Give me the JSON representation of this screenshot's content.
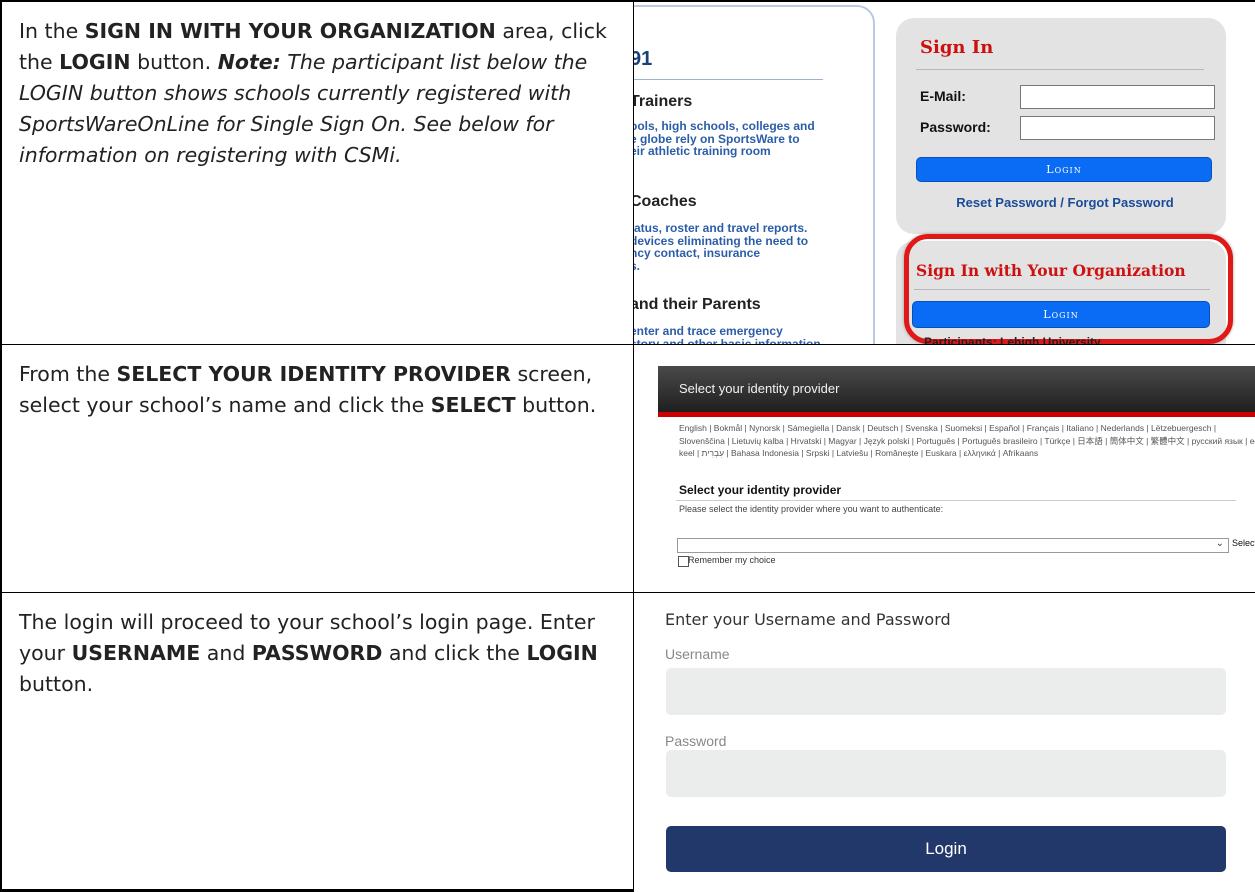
{
  "rows": [
    {
      "instruction": {
        "p1": "In the ",
        "b1": "SIGN IN WITH YOUR ORGANIZATION",
        "p2": " area, click the ",
        "b2": "LOGIN",
        "p3": " button. ",
        "note_label": "Note:",
        "note_text": " The participant list below the LOGIN button shows schools currently registered with SportsWareOnLine for Single Sign On. See below for information on registering with CSMi."
      }
    },
    {
      "instruction": {
        "p1": "From the ",
        "b1": "SELECT YOUR IDENTITY PROVIDER",
        "p2": " screen, select your school’s name and click the ",
        "b2": "SELECT",
        "p3": " button."
      }
    },
    {
      "instruction": {
        "p1": "The login will proceed to your school’s login page. Enter your ",
        "b1": "USERNAME",
        "p2": " and ",
        "b2": "PASSWORD",
        "p3": " and click the ",
        "b3": "LOGIN",
        "p4": " button."
      }
    }
  ],
  "shot1": {
    "left_title": "91",
    "sections": [
      {
        "heading": "Trainers",
        "text": "ools, high schools, colleges and\ne globe rely on SportsWare to\neir athletic training room"
      },
      {
        "heading": "Coaches",
        "text": "tatus, roster and travel reports.\ndevices eliminating the need to\nncy contact, insurance\ns."
      },
      {
        "heading": "and their Parents",
        "text": "enter and trace emergency\nstory and other basic information"
      }
    ],
    "signin_title": "Sign In",
    "email_label": "E-Mail:",
    "password_label": "Password:",
    "login_label": "Login",
    "reset_link": "Reset Password / Forgot Password",
    "org_title": "Sign In with Your Organization",
    "org_login_label": "Login",
    "cut_text": "Participants: Lehigh University",
    "highlight_color": "#e01818"
  },
  "shot2": {
    "header": "Select your identity provider",
    "languages_line1": "English | Bokmål | Nynorsk | Sámegiella | Dansk | Deutsch | Svenska | Suomeksi | Español | Français | Italiano | Nederlands | Lëtzebuergesch |",
    "languages_line2": "Slovenščina | Lietuvių kalba | Hrvatski | Magyar | Język polski | Português | Português brasileiro | Türkçe | 日本語 | 簡体中文 | 繁體中文 | русский язык | eesti",
    "languages_line3": "keel | עִבְרִית | Bahasa Indonesia | Srpski | Latviešu | Românește | Euskara | ελληνικά | Afrikaans",
    "heading": "Select your identity provider",
    "prompt": "Please select the identity provider where you want to authenticate:",
    "select_button": "Select",
    "remember": "Remember my choice"
  },
  "shot3": {
    "title": "Enter your Username and Password",
    "username_label": "Username",
    "password_label": "Password",
    "login_button": "Login",
    "button_color": "#22386a"
  }
}
